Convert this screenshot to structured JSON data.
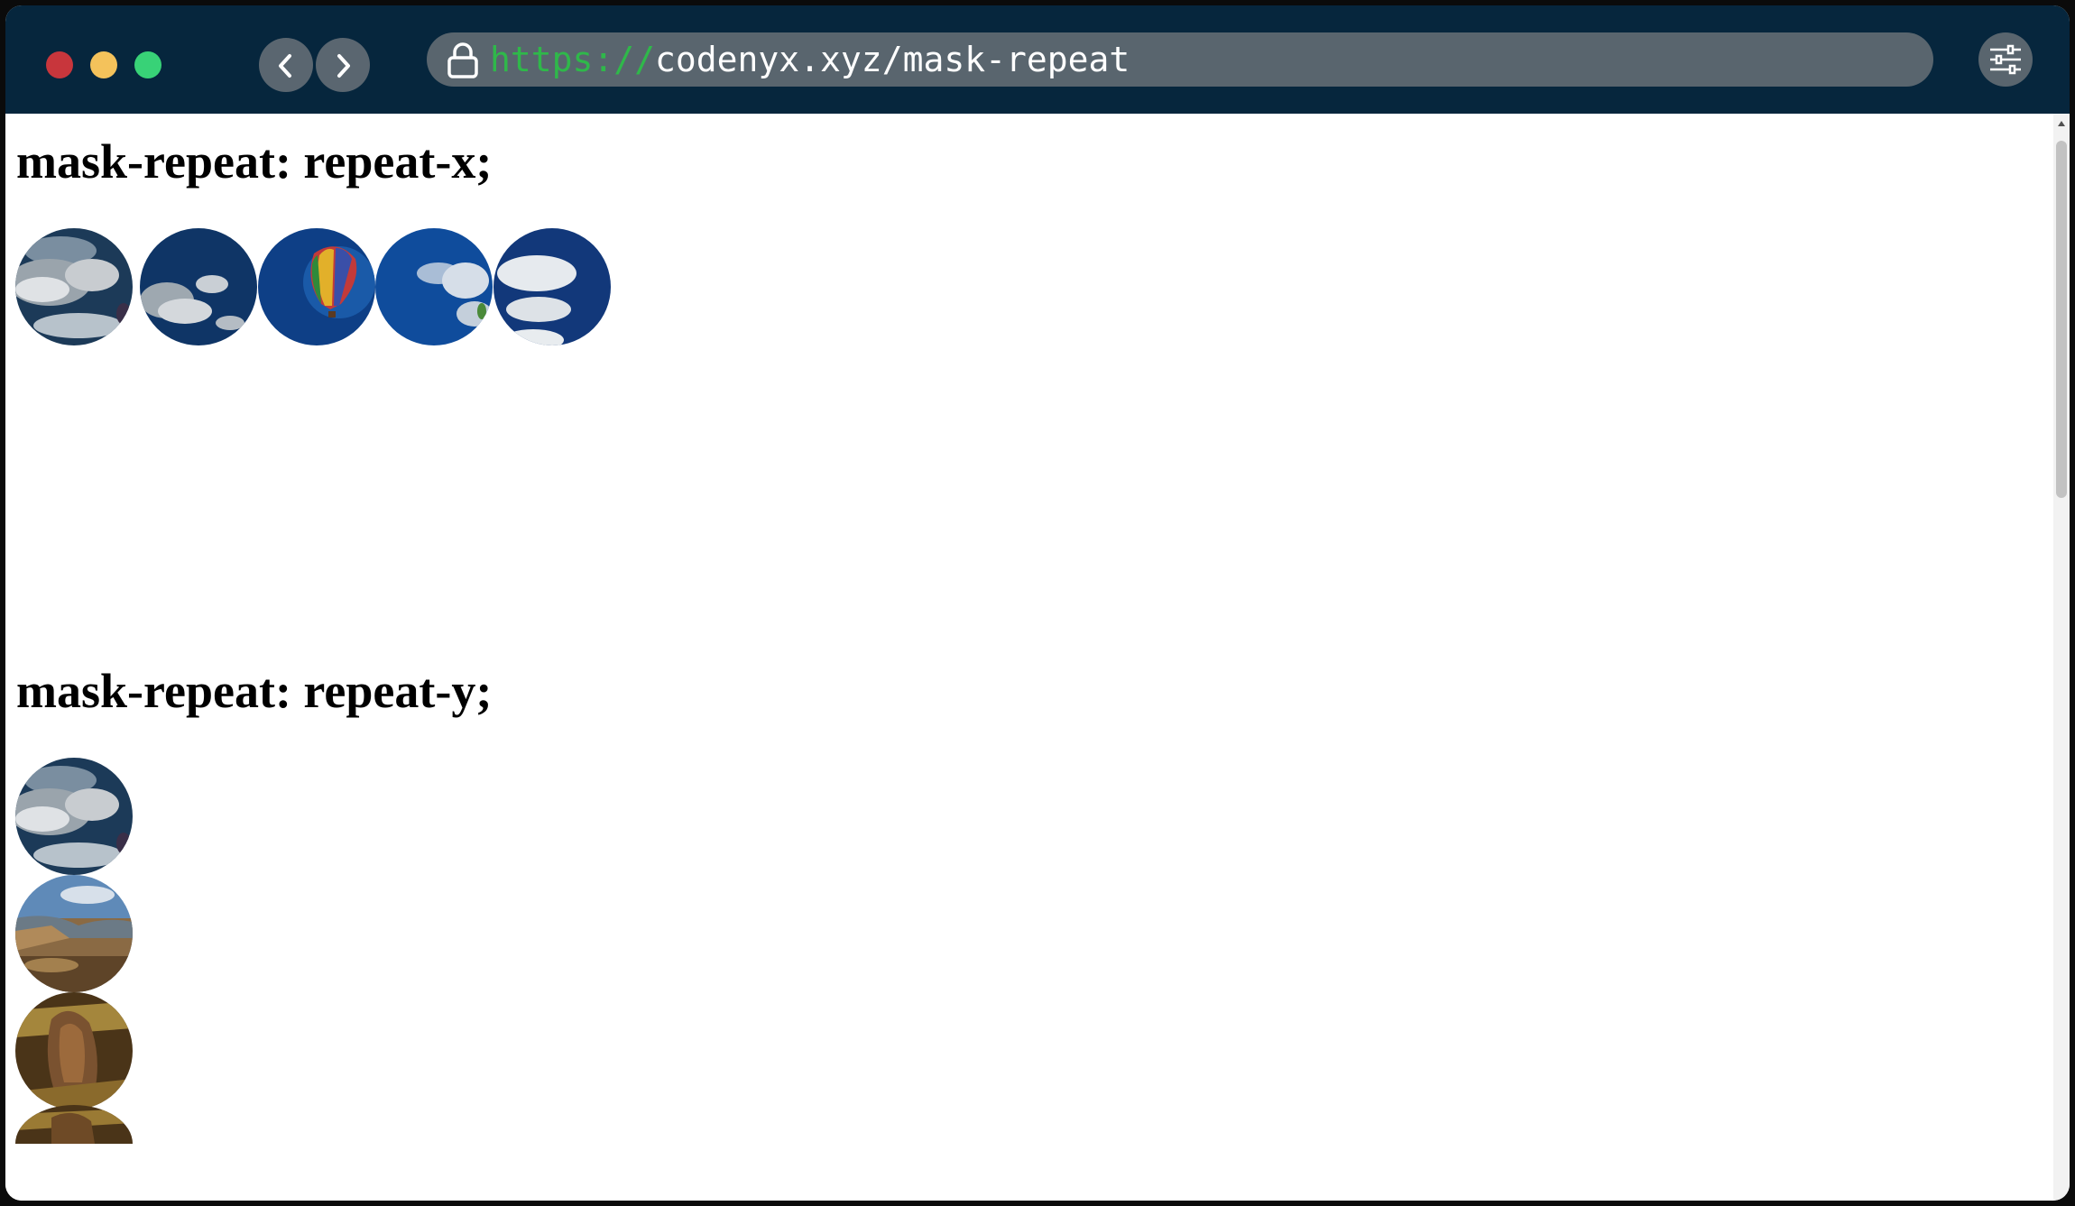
{
  "browser": {
    "url_scheme": "https://",
    "url_rest": "codenyx.xyz/mask-repeat",
    "back_icon": "chevron-left-icon",
    "forward_icon": "chevron-right-icon",
    "lock_icon": "lock-icon",
    "menu_icon": "sliders-icon",
    "colors": {
      "titlebar": "#06263d",
      "close": "#c8363c",
      "minimize": "#f4c25b",
      "maximize": "#38d277",
      "scheme": "#2fb84a"
    }
  },
  "page": {
    "sections": [
      {
        "heading": "mask-repeat: repeat-x;",
        "tiles": [
          "clouds",
          "clouds",
          "hot-air-balloon",
          "sky",
          "clouds"
        ]
      },
      {
        "heading": "mask-repeat: repeat-y;",
        "tiles": [
          "clouds",
          "canyon-landscape",
          "rock-formation",
          "rock-formation"
        ]
      }
    ]
  }
}
